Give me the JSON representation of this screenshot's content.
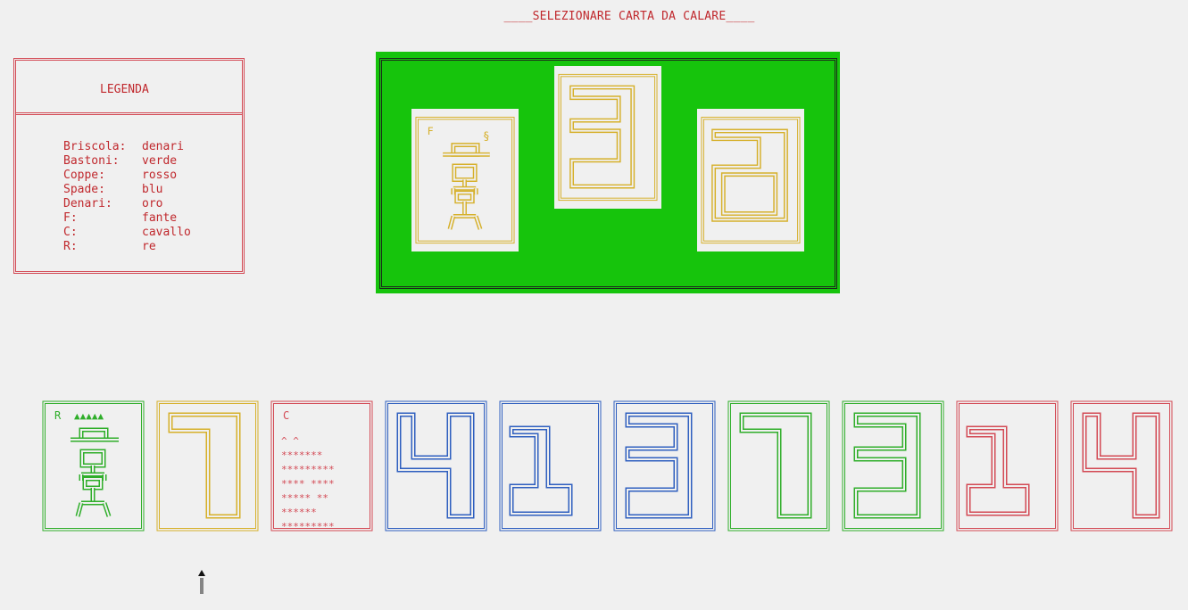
{
  "header": {
    "title": "____SELEZIONARE CARTA DA CALARE____"
  },
  "legend": {
    "title": "LEGENDA",
    "rows": [
      {
        "key": "Briscola:",
        "value": "denari"
      },
      {
        "key": "Bastoni:",
        "value": "verde"
      },
      {
        "key": "Coppe:",
        "value": "rosso"
      },
      {
        "key": "Spade:",
        "value": "blu"
      },
      {
        "key": "Denari:",
        "value": "oro"
      },
      {
        "key": "F:",
        "value": "fante"
      },
      {
        "key": "C:",
        "value": "cavallo"
      },
      {
        "key": "R:",
        "value": "re"
      }
    ]
  },
  "colors": {
    "table_felt": "#16c40c",
    "bastoni": "#2fae2a",
    "coppe": "#d34a55",
    "spade": "#2f5fbf",
    "denari": "#d6b02a"
  },
  "table": {
    "played_cards": [
      {
        "suit": "denari",
        "rank": "F",
        "corner_label": "F",
        "suit_symbol": "§"
      },
      {
        "suit": "denari",
        "rank": "3"
      },
      {
        "suit": "denari",
        "rank": "2"
      }
    ]
  },
  "hand": {
    "cards": [
      {
        "suit": "bastoni",
        "rank": "R",
        "corner_label": "R",
        "crown": "▲▲▲▲▲"
      },
      {
        "suit": "denari",
        "rank": "7"
      },
      {
        "suit": "coppe",
        "rank": "C",
        "corner_label": "C",
        "art_lines": [
          "   ^ ^",
          " *******",
          "*********",
          "****  ****",
          "*****   **",
          " ******",
          "*********"
        ]
      },
      {
        "suit": "spade",
        "rank": "4"
      },
      {
        "suit": "spade",
        "rank": "1"
      },
      {
        "suit": "spade",
        "rank": "3"
      },
      {
        "suit": "bastoni",
        "rank": "7"
      },
      {
        "suit": "bastoni",
        "rank": "3"
      },
      {
        "suit": "coppe",
        "rank": "1"
      },
      {
        "suit": "coppe",
        "rank": "4"
      }
    ],
    "selected_index": 1
  },
  "icons": {
    "selection_cursor": "up-arrow-icon"
  }
}
